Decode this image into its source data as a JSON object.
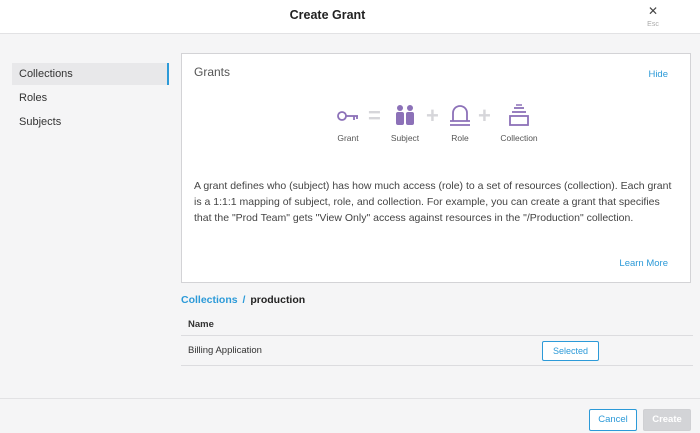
{
  "dialog": {
    "title": "Create Grant",
    "close_icon": "close-icon",
    "close_hint": "Esc"
  },
  "sidebar": {
    "items": [
      {
        "label": "Collections",
        "active": true
      },
      {
        "label": "Roles",
        "active": false
      },
      {
        "label": "Subjects",
        "active": false
      }
    ]
  },
  "grants_info": {
    "title": "Grants",
    "hide_label": "Hide",
    "formula": [
      {
        "icon": "key-icon",
        "label": "Grant"
      },
      {
        "icon": "users-icon",
        "label": "Subject"
      },
      {
        "icon": "scale-icon",
        "label": "Role"
      },
      {
        "icon": "stack-icon",
        "label": "Collection"
      }
    ],
    "description": "A grant defines who (subject) has how much access (role) to a set of resources (collection). Each grant is a 1:1:1 mapping of subject, role, and collection. For example, you can create a grant that specifies that the \"Prod Team\" gets \"View Only\" access against resources in the \"/Production\" collection.",
    "learn_more_label": "Learn More"
  },
  "breadcrumb": {
    "root": "Collections",
    "separator": "/",
    "current": "production"
  },
  "table": {
    "headers": [
      "Name"
    ],
    "rows": [
      {
        "name": "Billing Application",
        "action_label": "Selected"
      }
    ]
  },
  "footer": {
    "cancel_label": "Cancel",
    "create_label": "Create"
  },
  "colors": {
    "accent": "#2c9ad8",
    "icon_purple": "#8c71b8",
    "operator_gray": "#d6d6da"
  }
}
